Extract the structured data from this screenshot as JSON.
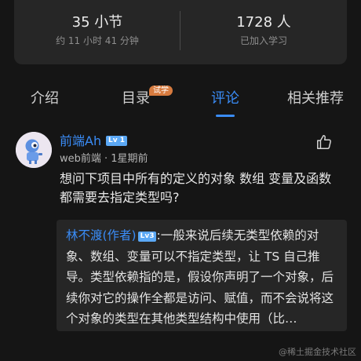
{
  "stats": {
    "lessons": {
      "value": "35 小节",
      "label": "约 11 小时 41 分钟"
    },
    "learners": {
      "value": "1728 人",
      "label": "已加入学习"
    }
  },
  "tabs": [
    {
      "label": "介绍",
      "active": false
    },
    {
      "label": "目录",
      "active": false,
      "badge": "试学"
    },
    {
      "label": "评论",
      "active": true
    },
    {
      "label": "相关推荐",
      "active": false
    }
  ],
  "comment": {
    "author": "前端Ah",
    "level": "Lv 1",
    "meta": "web前端 · 1星期前",
    "text": "想问下项目中所有的定义的对象 数组 变量及函数都需要去指定类型吗?",
    "like_icon": "thumbs-up-icon",
    "reply": {
      "author": "林不渡(作者)",
      "level": "Lv3",
      "text": ":一般来说后续无类型依赖的对象、数组、变量可以不指定类型，让 TS 自己推导。类型依赖指的是，假设你声明了一个对象，后续你对它的操作全都是访问、赋值，而不会说将这个对象的类型在其他类型结构中使用（比…"
    }
  },
  "watermark": "@稀土掘金技术社区",
  "colors": {
    "accent": "#3a8cf6",
    "badge_orange": "#d77b3f",
    "background": "#151515"
  }
}
